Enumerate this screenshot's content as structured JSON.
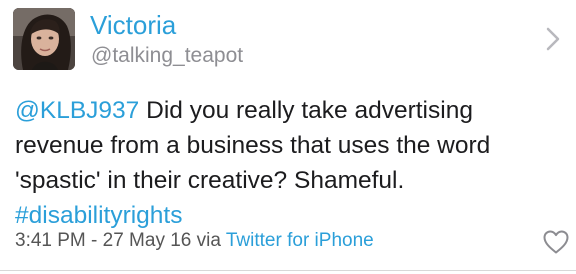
{
  "profile": {
    "name": "Victoria",
    "handle": "@talking_teapot"
  },
  "tweet": {
    "mention": "@KLBJ937",
    "line1_rest": " Did you really take advertising",
    "line2": "revenue from a business that uses the word",
    "line3": "'spastic' in their creative? Shameful.",
    "hashtag": "#disabilityrights"
  },
  "meta": {
    "timestamp": "3:41 PM - 27 May 16 via ",
    "source": "Twitter for iPhone"
  },
  "icons": {
    "chevron": "chevron-right-icon",
    "like": "heart-icon",
    "avatar": "profile-photo"
  },
  "colors": {
    "link": "#2b9fd9",
    "text": "#1c1c1e",
    "secondary": "#8e8e93"
  }
}
